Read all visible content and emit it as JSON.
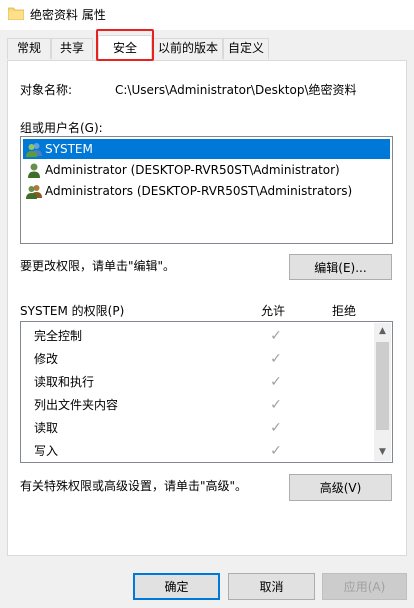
{
  "window": {
    "title": "绝密资料 属性"
  },
  "tabs": [
    {
      "label": "常规"
    },
    {
      "label": "共享"
    },
    {
      "label": "安全",
      "active": true
    },
    {
      "label": "以前的版本"
    },
    {
      "label": "自定义"
    }
  ],
  "security": {
    "object_name_label": "对象名称:",
    "object_name_value": "C:\\Users\\Administrator\\Desktop\\绝密资料",
    "groups_label": "组或用户名(G):",
    "groups": [
      {
        "name": "SYSTEM",
        "icon": "users-group-icon",
        "selected": true
      },
      {
        "name": "Administrator (DESKTOP-RVR50ST\\Administrator)",
        "icon": "user-icon",
        "selected": false
      },
      {
        "name": "Administrators (DESKTOP-RVR50ST\\Administrators)",
        "icon": "users-group-icon",
        "selected": false
      }
    ],
    "change_perm_text": "要更改权限，请单击\"编辑\"。",
    "edit_button": "编辑(E)...",
    "permissions_label": "SYSTEM 的权限(P)",
    "allow_header": "允许",
    "deny_header": "拒绝",
    "permissions": [
      {
        "name": "完全控制",
        "allow": true,
        "deny": false
      },
      {
        "name": "修改",
        "allow": true,
        "deny": false
      },
      {
        "name": "读取和执行",
        "allow": true,
        "deny": false
      },
      {
        "name": "列出文件夹内容",
        "allow": true,
        "deny": false
      },
      {
        "name": "读取",
        "allow": true,
        "deny": false
      },
      {
        "name": "写入",
        "allow": true,
        "deny": false
      }
    ],
    "check_glyph": "✓",
    "advanced_text": "有关特殊权限或高级设置，请单击\"高级\"。",
    "advanced_button": "高级(V)"
  },
  "footer": {
    "ok": "确定",
    "cancel": "取消",
    "apply": "应用(A)"
  },
  "colors": {
    "selection": "#0078d7",
    "tab_highlight": "#e8211e",
    "folder": "#f8d775"
  }
}
